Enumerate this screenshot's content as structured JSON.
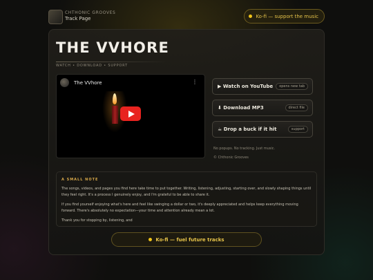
{
  "header": {
    "brand": "CHTHONIC GROOVES",
    "subtitle": "Track Page",
    "kofi_label": "Ko-fi — support the music"
  },
  "hero": {
    "title": "THE VVHORE",
    "tagline": "WATCH • DOWNLOAD • SUPPORT"
  },
  "video": {
    "title": "The VVhore",
    "menu_glyph": "⋮"
  },
  "actions": [
    {
      "label": "▶ Watch on YouTube",
      "badge": "opens new tab"
    },
    {
      "label": "⬇ Download MP3",
      "badge": "direct file"
    },
    {
      "label": "☕ Drop a buck if it hit",
      "badge": "support"
    }
  ],
  "side_notes": {
    "privacy": "No popups. No tracking. Just music.",
    "copyright": "© Chthonic Grooves"
  },
  "note": {
    "heading": "A SMALL NOTE",
    "paragraphs": [
      "The songs, videos, and pages you find here take time to put together. Writing, listening, adjusting, starting over, and slowly shaping things until they feel right. It's a process I genuinely enjoy, and I'm grateful to be able to share it.",
      "If you find yourself enjoying what's here and feel like swinging a dollar or two, it's deeply appreciated and helps keep everything moving forward. There's absolutely no expectation—your time and attention already mean a lot.",
      "Thank you for stopping by, listening, and"
    ]
  },
  "footer": {
    "kofi_label": "Ko-fi — fuel future tracks"
  },
  "colors": {
    "accent_gold": "#e6c34a",
    "youtube_red": "#e8231f",
    "heading_amber": "#d7a84a"
  }
}
